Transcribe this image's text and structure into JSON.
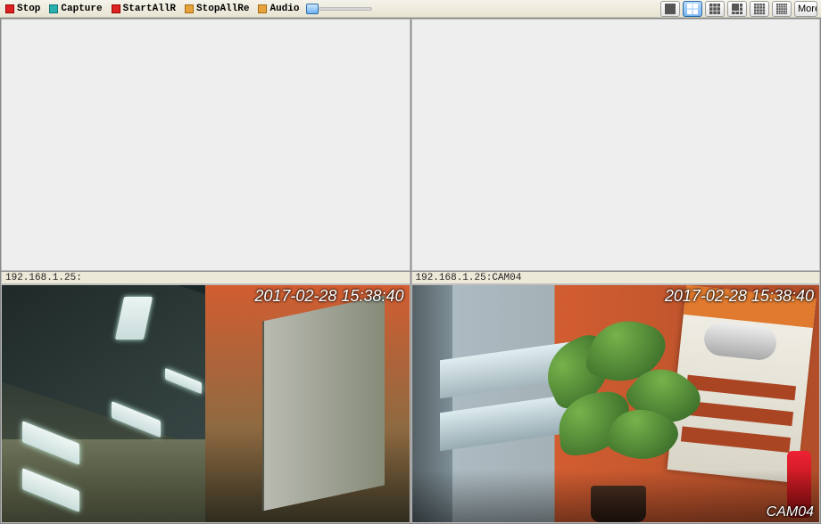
{
  "toolbar": {
    "stop": "Stop",
    "capture": "Capture",
    "start_all": "StartAllR",
    "stop_all": "StopAllRe",
    "audio": "Audio",
    "more": "More"
  },
  "layout_icons": [
    "1x1",
    "2x2",
    "3x3",
    "2+4",
    "4x4",
    "5x5"
  ],
  "layout_active_index": 1,
  "panes": {
    "p3": {
      "label": "192.168.1.25:",
      "timestamp": "2017-02-28 15:38:40",
      "cam": ""
    },
    "p4": {
      "label": "192.168.1.25:CAM04",
      "timestamp": "2017-02-28 15:38:40",
      "cam": "CAM04"
    }
  }
}
